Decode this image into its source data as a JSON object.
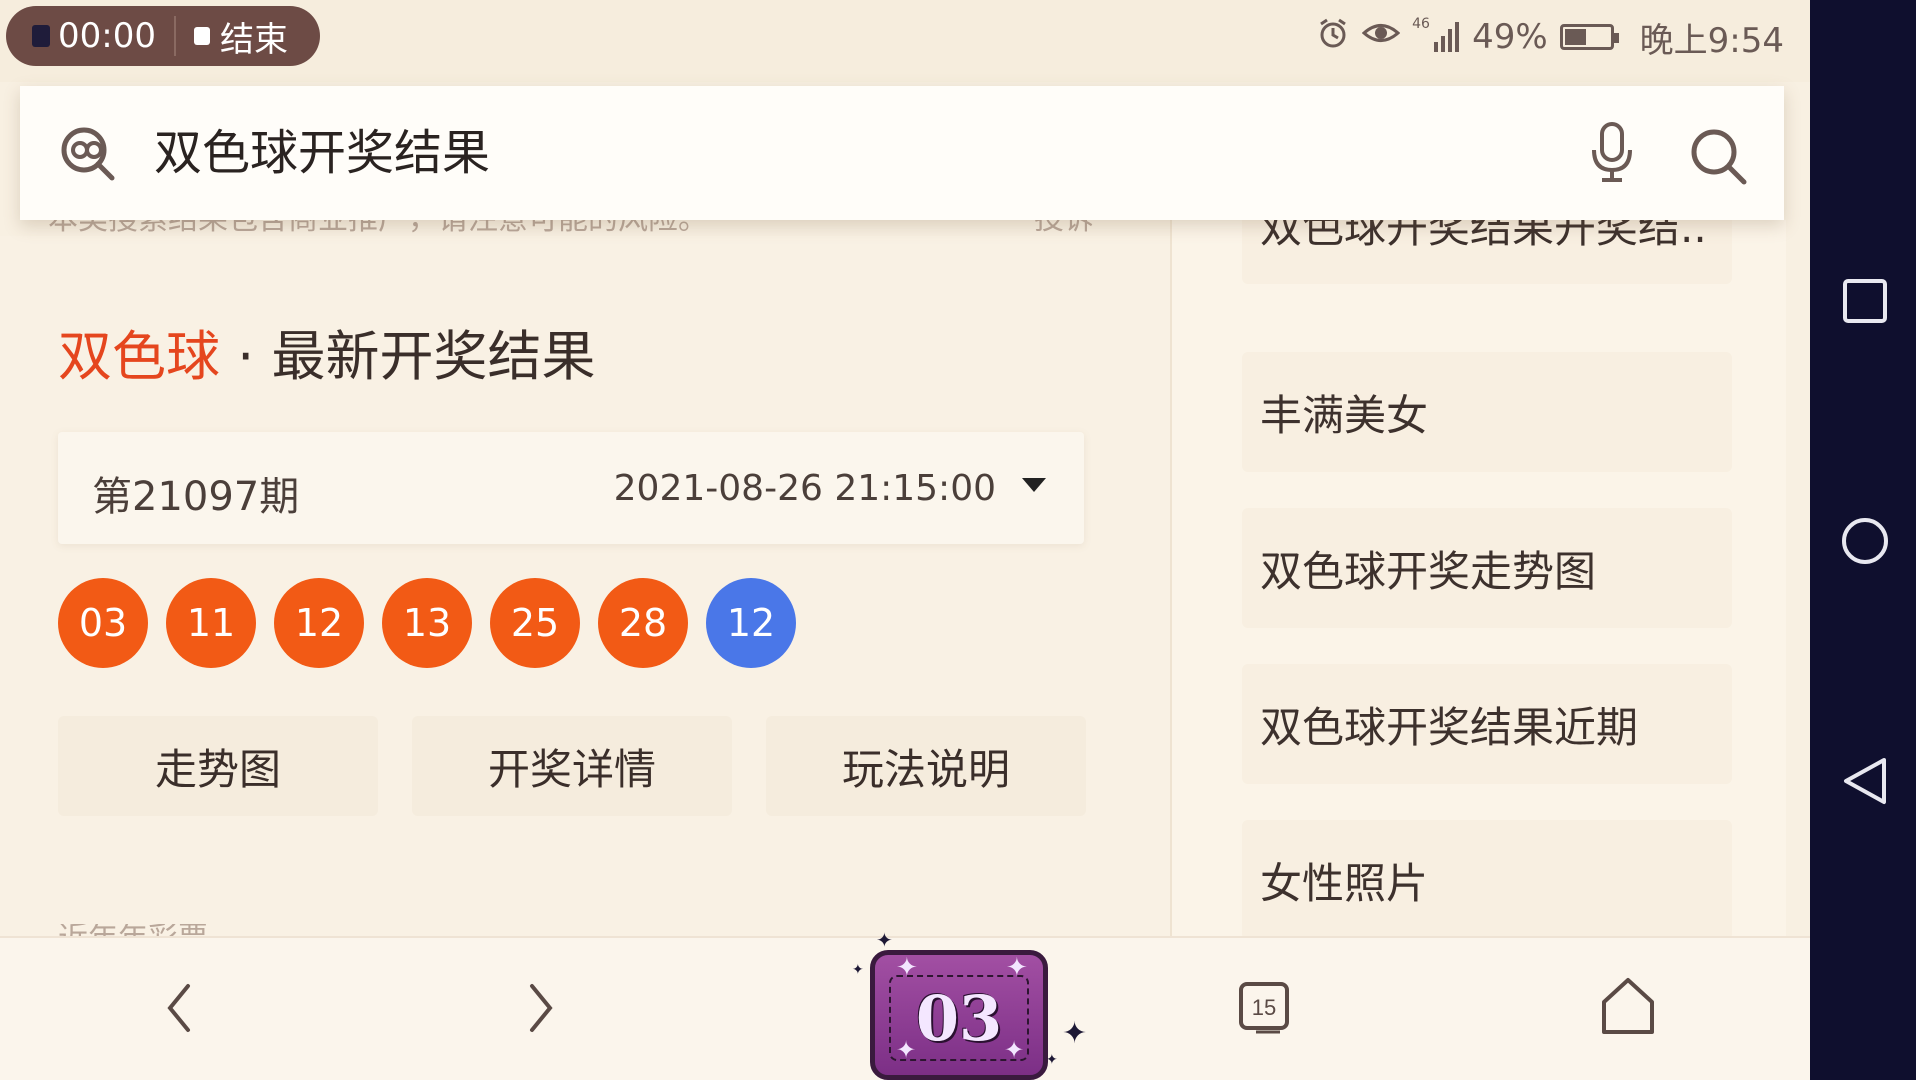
{
  "status_bar": {
    "record_time": "00:00",
    "end_label": "结束",
    "signal_text": "46",
    "battery_percent": "49%",
    "time": "晚上9:54"
  },
  "search": {
    "query": "双色球开奖结果"
  },
  "faded_notice": {
    "left_text": "本类搜索结果包含商业推广，请注意可能的风险。",
    "right_text": "投诉"
  },
  "result_card": {
    "title_accent": "双色球",
    "title_rest": " · 最新开奖结果",
    "issue_number": "第21097期",
    "draw_datetime": "2021-08-26 21:15:00",
    "red_balls": [
      "03",
      "11",
      "12",
      "13",
      "25",
      "28"
    ],
    "blue_ball": "12",
    "actions": [
      "走势图",
      "开奖详情",
      "玩法说明"
    ],
    "more_text": "近年年彩票"
  },
  "suggestions": [
    "双色球开奖结果开奖结..",
    "丰满美女",
    "双色球开奖走势图",
    "双色球开奖结果近期",
    "女性照片"
  ],
  "bottom_bar": {
    "tabs_count": "15"
  },
  "badge": {
    "value": "03"
  },
  "colors": {
    "accent_red": "#e5461e",
    "ball_red": "#f25a15",
    "ball_blue": "#4a77e8",
    "badge_purple": "#9a47a0"
  },
  "icons": {
    "search_logo": "search-logo-icon",
    "mic": "microphone-icon",
    "search": "search-icon",
    "back": "chevron-left-icon",
    "forward": "chevron-right-icon",
    "tabs": "tabs-icon",
    "home": "home-icon",
    "sys_recent": "square-icon",
    "sys_home": "circle-icon",
    "sys_back": "triangle-back-icon"
  }
}
